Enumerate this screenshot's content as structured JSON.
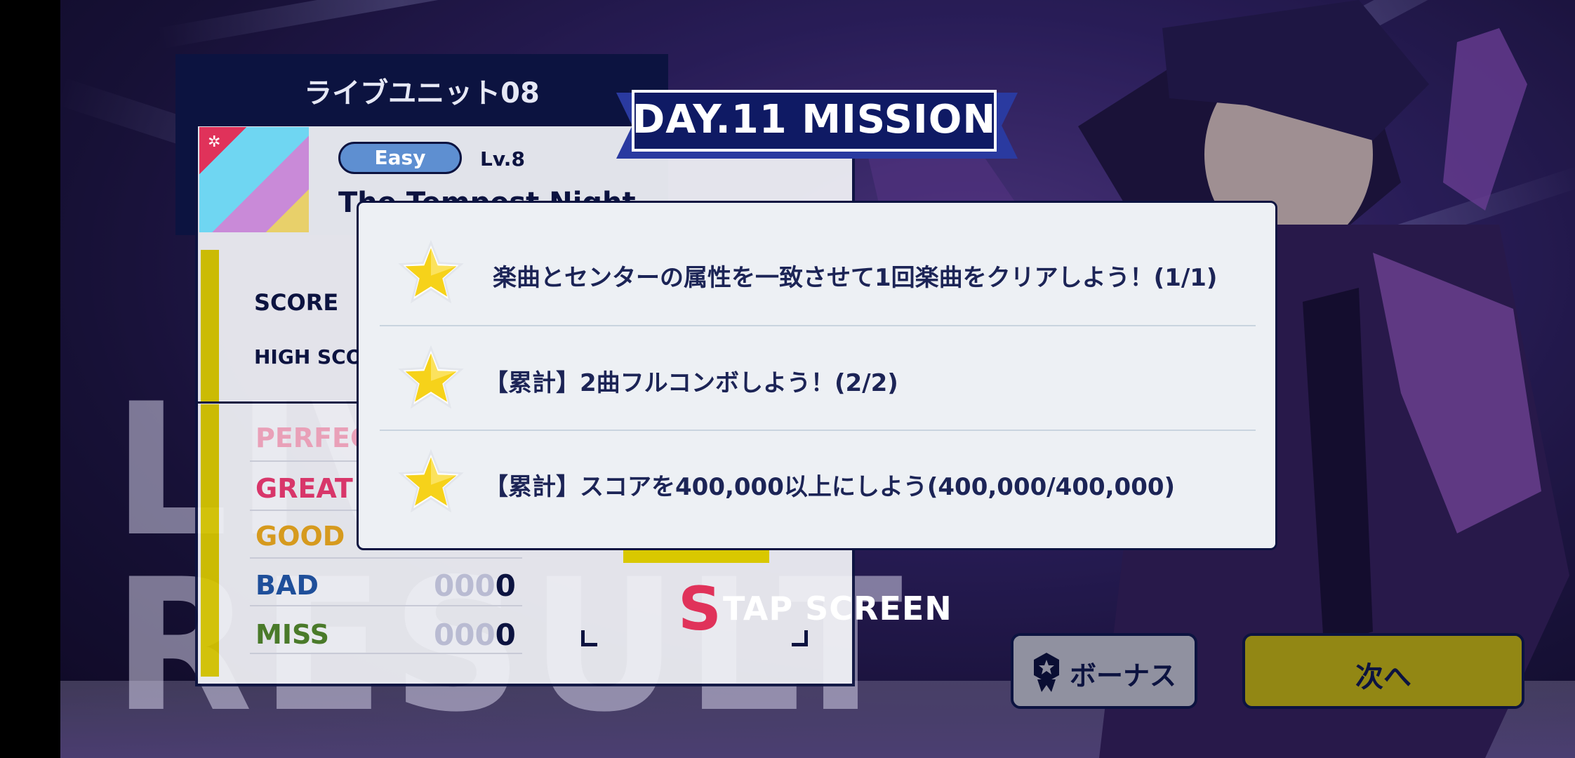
{
  "unit_title": "ライブユニット08",
  "song": {
    "difficulty": "Easy",
    "level": "Lv.8",
    "title": "The Tempest Night"
  },
  "score_labels": {
    "score": "SCORE",
    "high_score": "HIGH SCORE"
  },
  "judgements": [
    {
      "label": "PERFECT",
      "color": "#e9a0b8"
    },
    {
      "label": "GREAT",
      "color": "#d8366a"
    },
    {
      "label": "GOOD",
      "color": "#d69a1e"
    },
    {
      "label": "BAD",
      "count_dim": "000",
      "count": "0",
      "color": "#1f4f9a"
    },
    {
      "label": "MISS",
      "count_dim": "000",
      "count": "0",
      "color": "#4a7a2a"
    }
  ],
  "background_word": {
    "line1": "LIVE",
    "line2": "RESULT"
  },
  "tap_screen": {
    "s": "S",
    "text": "TAP SCREEN"
  },
  "mission": {
    "title": "DAY.11 MISSION",
    "items": [
      {
        "text": "楽曲とセンターの属性を一致させて1回楽曲をクリアしよう！(1/1)",
        "icon": "star-icon"
      },
      {
        "text": "【累計】2曲フルコンボしよう！(2/2)",
        "icon": "star-icon"
      },
      {
        "text": "【累計】スコアを400,000以上にしよう(400,000/400,000)",
        "icon": "star-icon"
      }
    ]
  },
  "buttons": {
    "bonus": "ボーナス",
    "next": "次へ"
  },
  "colors": {
    "navy": "#0c1340",
    "accent_yellow": "#dccd10",
    "star": "#f6d21a"
  }
}
